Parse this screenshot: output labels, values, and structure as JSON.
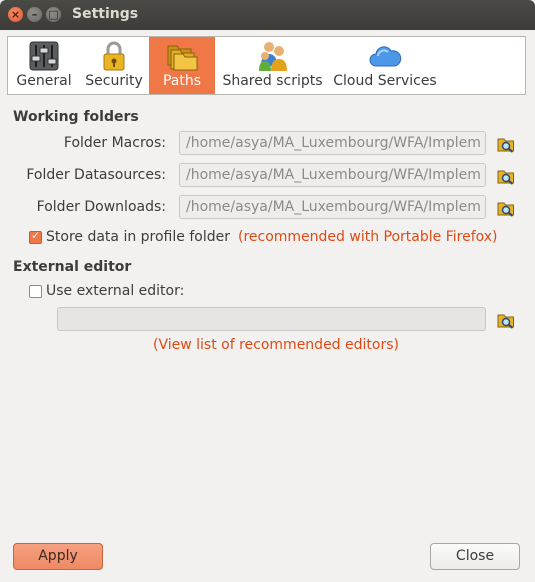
{
  "window": {
    "title": "Settings",
    "close_glyph": "×",
    "minimize_glyph": "–",
    "maximize_glyph": "□"
  },
  "tabs": [
    {
      "label": "General",
      "icon": "sliders-icon",
      "active": false
    },
    {
      "label": "Security",
      "icon": "padlock-icon",
      "active": false
    },
    {
      "label": "Paths",
      "icon": "folders-icon",
      "active": true
    },
    {
      "label": "Shared scripts",
      "icon": "users-icon",
      "active": false
    },
    {
      "label": "Cloud Services",
      "icon": "cloud-icon",
      "active": false
    }
  ],
  "working_folders": {
    "title": "Working folders",
    "macros": {
      "label": "Folder Macros:",
      "value": "/home/asya/MA_Luxembourg/WFA/Implem"
    },
    "datasources": {
      "label": "Folder Datasources:",
      "value": "/home/asya/MA_Luxembourg/WFA/Implem"
    },
    "downloads": {
      "label": "Folder Downloads:",
      "value": "/home/asya/MA_Luxembourg/WFA/Implem"
    },
    "store_profile": {
      "label": "Store data in profile folder",
      "checked": true
    },
    "recommend_link": "(recommended with Portable Firefox)"
  },
  "external_editor": {
    "title": "External editor",
    "use_label": "Use external editor:",
    "checked": false,
    "path_value": "",
    "editors_link": "(View list of recommended editors)"
  },
  "buttons": {
    "apply": "Apply",
    "close": "Close"
  },
  "colors": {
    "accent": "#f07746",
    "link": "#df4a14",
    "titlebar": "#3c3b37"
  }
}
